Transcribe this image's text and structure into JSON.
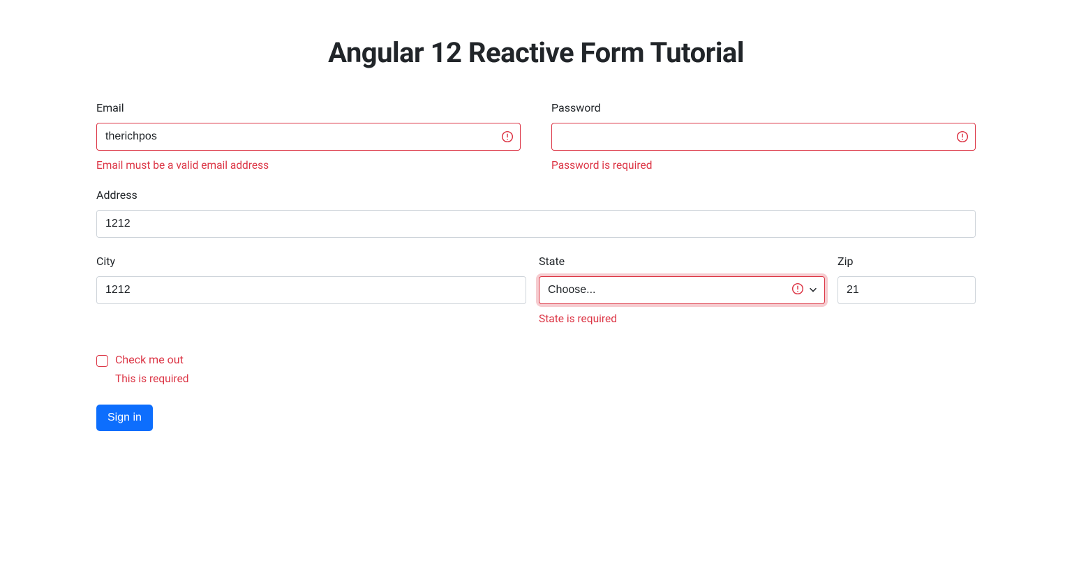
{
  "title": "Angular 12 Reactive Form Tutorial",
  "form": {
    "email": {
      "label": "Email",
      "value": "therichpos",
      "error": "Email must be a valid email address"
    },
    "password": {
      "label": "Password",
      "value": "",
      "error": "Password is required"
    },
    "address": {
      "label": "Address",
      "value": "1212"
    },
    "city": {
      "label": "City",
      "value": "1212"
    },
    "state": {
      "label": "State",
      "selected": "Choose...",
      "error": "State is required"
    },
    "zip": {
      "label": "Zip",
      "value": "21"
    },
    "checkbox": {
      "label": "Check me out",
      "error": "This is required"
    },
    "submit": "Sign in"
  }
}
